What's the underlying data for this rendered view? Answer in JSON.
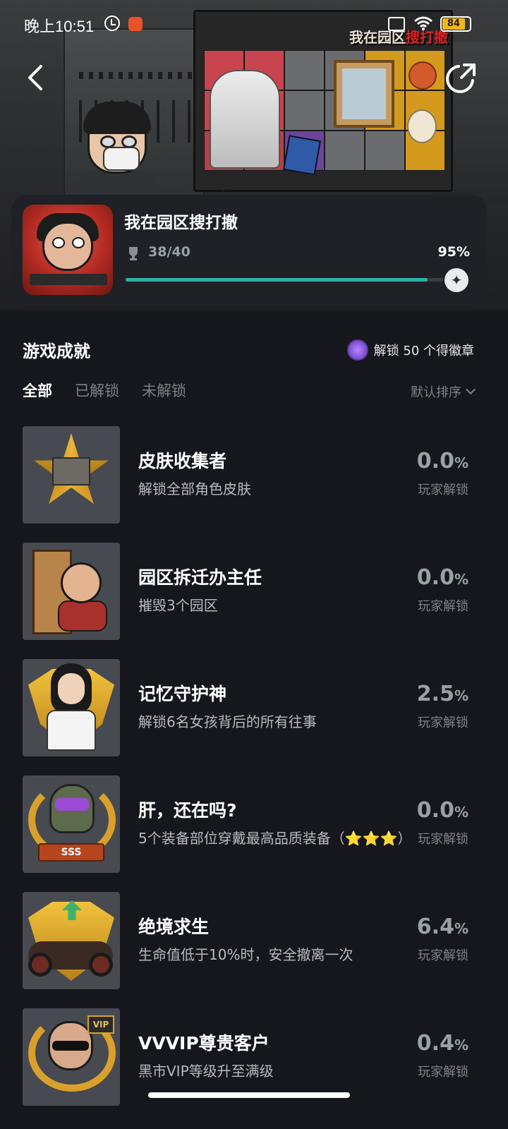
{
  "status_bar": {
    "time": "晚上10:51",
    "battery": "84"
  },
  "hero": {
    "board_logo_prefix": "我在园区",
    "board_logo_suffix": "搜打撤"
  },
  "game": {
    "title": "我在园区搜打撤",
    "trophy_count": "38/40",
    "progress_percent": "95%",
    "progress_fraction": 0.95
  },
  "achievements": {
    "section_title": "游戏成就",
    "badge_reward": "解锁 50 个得徽章",
    "tabs": [
      "全部",
      "已解锁",
      "未解锁"
    ],
    "sort_label": "默认排序",
    "rate_label": "玩家解锁",
    "items": [
      {
        "title": "皮肤收集者",
        "desc": "解锁全部角色皮肤",
        "rate": "0.0",
        "unit": "%",
        "icon": "star-badge-icon"
      },
      {
        "title": "园区拆迁办主任",
        "desc": "摧毁3个园区",
        "rate": "0.0",
        "unit": "%",
        "icon": "door-breaker-icon"
      },
      {
        "title": "记忆守护神",
        "desc": "解锁6名女孩背后的所有往事",
        "rate": "2.5",
        "unit": "%",
        "icon": "girl-shield-icon"
      },
      {
        "title": "肝，还在吗?",
        "desc": "5个装备部位穿戴最高品质装备（⭐⭐⭐）",
        "rate": "0.0",
        "unit": "%",
        "icon": "soldier-laurel-icon",
        "ribbon": "SSS"
      },
      {
        "title": "绝境求生",
        "desc": "生命值低于10%时，安全撤离一次",
        "rate": "6.4",
        "unit": "%",
        "icon": "motorcycle-shield-icon"
      },
      {
        "title": "VVVIP尊贵客户",
        "desc": "黑市VIP等级升至满级",
        "rate": "0.4",
        "unit": "%",
        "icon": "vip-laurel-icon",
        "tag": "VIP"
      }
    ]
  }
}
